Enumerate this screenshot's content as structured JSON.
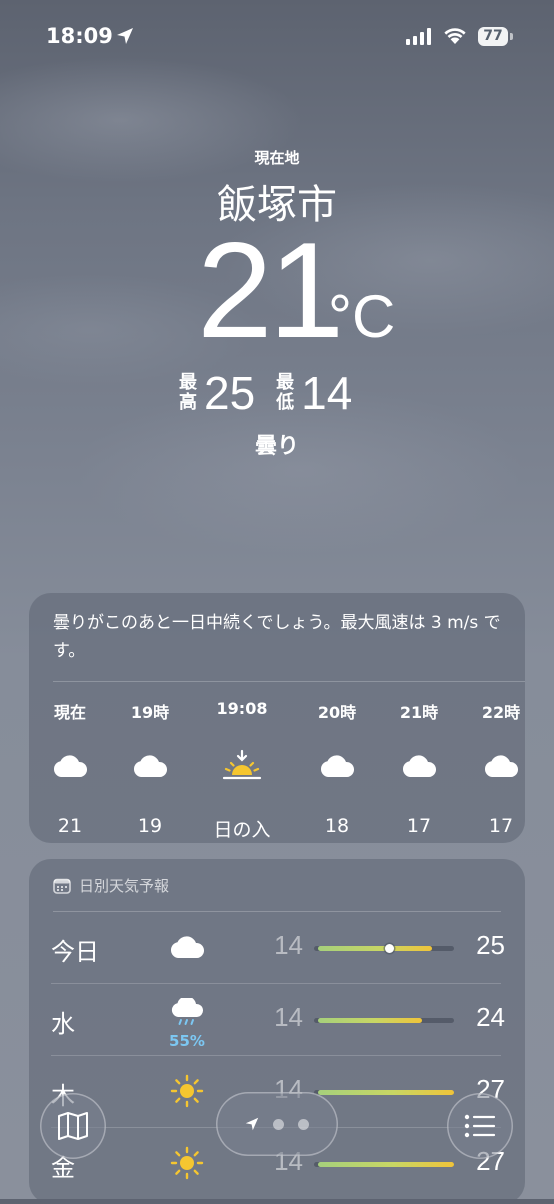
{
  "status_bar": {
    "time": "18:09",
    "battery": "77"
  },
  "location": {
    "label": "現在地",
    "city": "飯塚市"
  },
  "current": {
    "temp": "21",
    "unit": "°C",
    "high_label": "最高",
    "high": "25",
    "low_label": "最低",
    "low": "14",
    "condition": "曇り"
  },
  "hourly": {
    "summary": "曇りがこのあと一日中続くでしょう。最大風速は 3 m/s です。",
    "items": [
      {
        "label": "現在",
        "icon": "cloud-icon",
        "value": "21"
      },
      {
        "label": "19時",
        "icon": "cloud-icon",
        "value": "19"
      },
      {
        "label": "19:08",
        "icon": "sunset-icon",
        "value": "日の入"
      },
      {
        "label": "20時",
        "icon": "cloud-icon",
        "value": "18"
      },
      {
        "label": "21時",
        "icon": "cloud-icon",
        "value": "17"
      },
      {
        "label": "22時",
        "icon": "cloud-icon",
        "value": "17"
      }
    ]
  },
  "daily": {
    "header": "日別天気予報",
    "range": [
      14,
      27
    ],
    "rows": [
      {
        "day": "今日",
        "icon": "cloud-icon",
        "precip": "",
        "low": "14",
        "high": "25",
        "current": 21
      },
      {
        "day": "水",
        "icon": "cloud-rain-icon",
        "precip": "55%",
        "low": "14",
        "high": "24"
      },
      {
        "day": "木",
        "icon": "sun-icon",
        "precip": "",
        "low": "14",
        "high": "27"
      },
      {
        "day": "金",
        "icon": "sun-icon",
        "precip": "",
        "low": "14",
        "high": "27"
      }
    ]
  },
  "colors": {
    "precip": "#7cc7f2",
    "sun": "#f5c630",
    "bar_warm": "#f0c43a",
    "bar_cool": "#a6d07c"
  }
}
